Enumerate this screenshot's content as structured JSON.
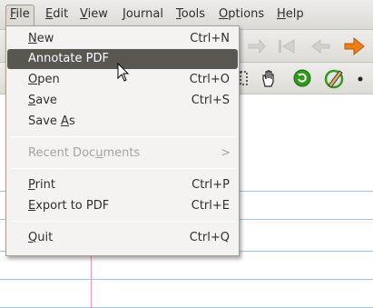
{
  "menubar": {
    "items": [
      {
        "label": "File",
        "u": "F",
        "rest": "ile"
      },
      {
        "label": "Edit",
        "u": "E",
        "rest": "dit"
      },
      {
        "label": "View",
        "u": "V",
        "rest": "iew"
      },
      {
        "label": "Journal",
        "u": "J",
        "rest": "ournal"
      },
      {
        "label": "Tools",
        "u": "T",
        "rest": "ools"
      },
      {
        "label": "Options",
        "u": "O",
        "rest": "ptions"
      },
      {
        "label": "Help",
        "u": "H",
        "rest": "elp"
      }
    ]
  },
  "file_menu": {
    "new": {
      "pre": "",
      "u": "N",
      "post": "ew",
      "accel": "Ctrl+N"
    },
    "annotate": {
      "label": "Annotate PDF"
    },
    "open": {
      "pre": "",
      "u": "O",
      "post": "pen",
      "accel": "Ctrl+O"
    },
    "save": {
      "pre": "",
      "u": "S",
      "post": "ave",
      "accel": "Ctrl+S"
    },
    "save_as": {
      "pre": "Save ",
      "u": "A",
      "post": "s"
    },
    "recent": {
      "pre": "Recent Doc",
      "u": "u",
      "post": "ments",
      "arrow": ">"
    },
    "print": {
      "pre": "",
      "u": "P",
      "post": "rint",
      "accel": "Ctrl+P"
    },
    "export": {
      "pre": "",
      "u": "E",
      "post": "xport to PDF",
      "accel": "Ctrl+E"
    },
    "quit": {
      "pre": "",
      "u": "Q",
      "post": "uit",
      "accel": "Ctrl+Q"
    }
  },
  "icons": {
    "toolbar1": [
      "redo-icon",
      "first-page-icon",
      "previous-page-icon",
      "next-page-icon"
    ],
    "toolbar2": [
      "select-icon",
      "hand-tool-icon",
      "default-pen-icon",
      "shape-recognizer-icon",
      "thin-dot-icon"
    ]
  },
  "colors": {
    "highlight": "#5a5752",
    "ruling": "#a9c2e6",
    "margin": "#ea9ac2",
    "arrow_orange": "#f07d16",
    "green": "#2f9a1c"
  }
}
